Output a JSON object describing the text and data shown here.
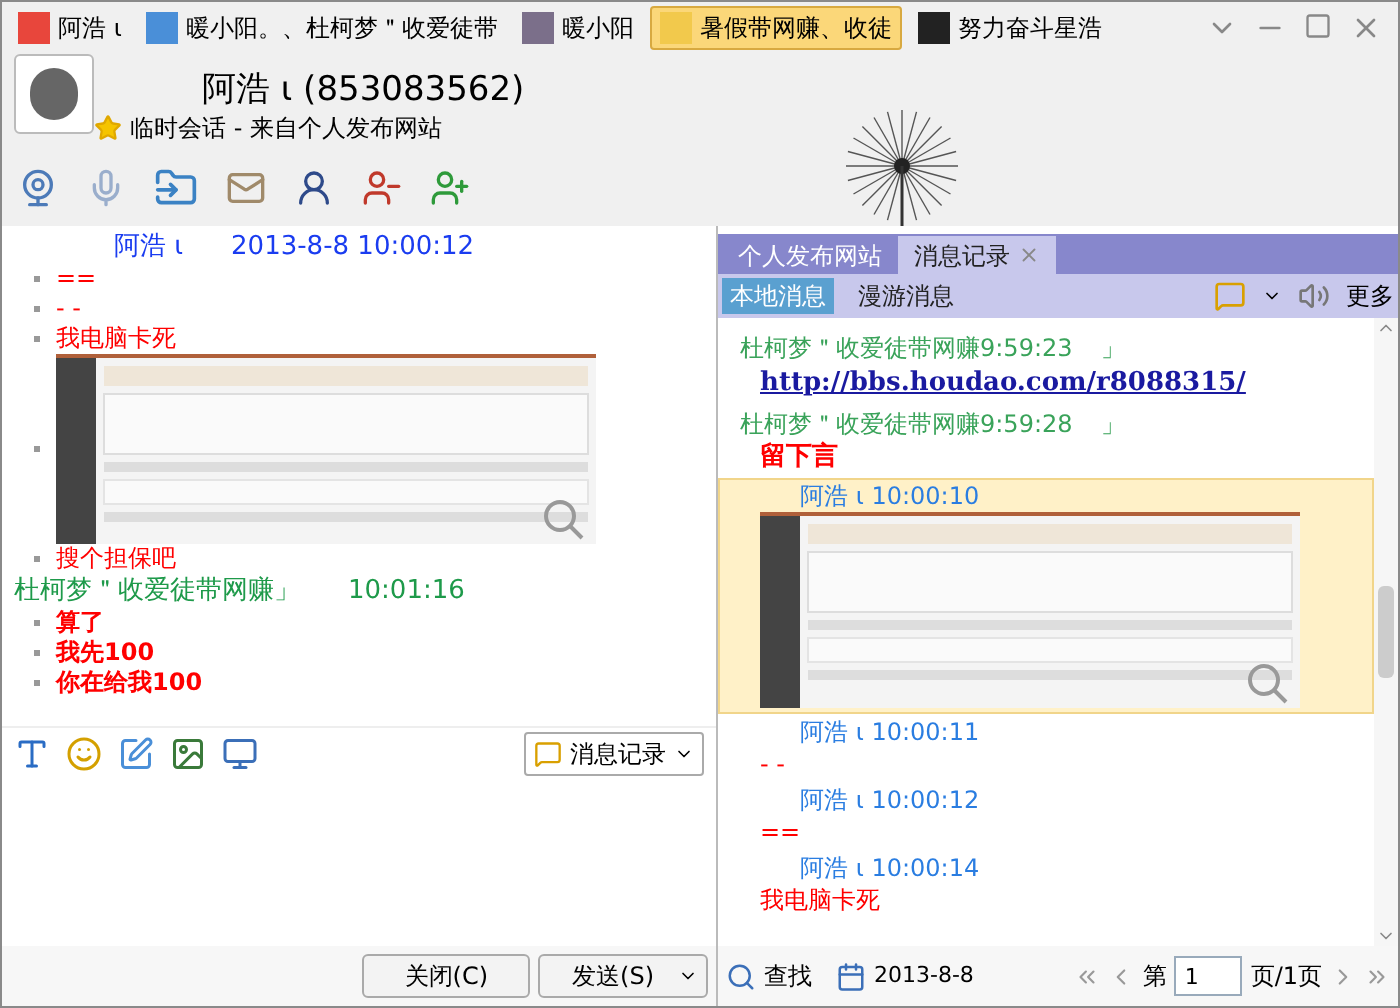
{
  "tabs": [
    {
      "label": "阿浩 ι",
      "selected": false,
      "color": "#e8463c"
    },
    {
      "label": "暖小阳。、杜柯梦＂收爱徒带",
      "selected": false,
      "color": "#4a8fd8"
    },
    {
      "label": "暖小阳",
      "selected": false,
      "color": "#7b6f8a"
    },
    {
      "label": "暑假带网赚、收徒",
      "selected": true,
      "color": "#f2c94c"
    },
    {
      "label": "努力奋斗星浩",
      "selected": false,
      "color": "#222222"
    }
  ],
  "contact": {
    "name": "阿浩 ι (853083562)",
    "subtitle": "临时会话 - 来自个人发布网站"
  },
  "chat": {
    "messages": [
      {
        "sender": "阿浩 ι",
        "time": "2013-8-8 10:00:12",
        "color": "#1a3cf0",
        "lines": [
          {
            "kind": "text",
            "text": "==",
            "bold": false
          },
          {
            "kind": "text",
            "text": "- -",
            "bold": false
          },
          {
            "kind": "text",
            "text": "我电脑卡死",
            "bold": false
          },
          {
            "kind": "image"
          },
          {
            "kind": "text",
            "text": "搜个担保吧",
            "bold": false
          }
        ]
      },
      {
        "sender": "杜柯梦＂收爱徒带网赚」",
        "time": "10:01:16",
        "color": "#1e9a4a",
        "lines": [
          {
            "kind": "text",
            "text": "算了",
            "bold": true
          },
          {
            "kind": "text",
            "text": "我先100",
            "bold": true
          },
          {
            "kind": "text",
            "text": "你在给我100",
            "bold": true
          }
        ]
      }
    ]
  },
  "history_button": "消息记录",
  "buttons": {
    "close": "关闭(C)",
    "send": "发送(S)"
  },
  "history": {
    "tabs": [
      {
        "label": "个人发布网站",
        "selected": false
      },
      {
        "label": "消息记录",
        "selected": true
      }
    ],
    "subtabs": [
      {
        "label": "本地消息",
        "selected": true
      },
      {
        "label": "漫游消息",
        "selected": false
      }
    ],
    "more": "更多",
    "entries": [
      {
        "header": "杜柯梦＂收爱徒带网赚9:59:23",
        "suffix": "」",
        "color": "#3aa35a",
        "selected": false,
        "lines": [
          {
            "kind": "link",
            "text": "http://bbs.houdao.com/r8088315/"
          }
        ]
      },
      {
        "header": "杜柯梦＂收爱徒带网赚9:59:28",
        "suffix": "」",
        "color": "#3aa35a",
        "selected": false,
        "lines": [
          {
            "kind": "bold",
            "text": "留下言"
          }
        ]
      },
      {
        "header": "阿浩 ι 10:00:10",
        "color": "#2a7de1",
        "selected": true,
        "lines": [
          {
            "kind": "image"
          }
        ]
      },
      {
        "header": "阿浩 ι 10:00:11",
        "color": "#2a7de1",
        "selected": false,
        "lines": [
          {
            "kind": "text",
            "text": "- -"
          }
        ]
      },
      {
        "header": "阿浩 ι 10:00:12",
        "color": "#2a7de1",
        "selected": false,
        "lines": [
          {
            "kind": "text",
            "text": "=="
          }
        ]
      },
      {
        "header": "阿浩 ι 10:00:14",
        "color": "#2a7de1",
        "selected": false,
        "lines": [
          {
            "kind": "text",
            "text": "我电脑卡死"
          }
        ]
      }
    ],
    "search": "查找",
    "date": "2013-8-8",
    "page_prefix": "第",
    "page": "1",
    "page_suffix": "页/1页"
  }
}
